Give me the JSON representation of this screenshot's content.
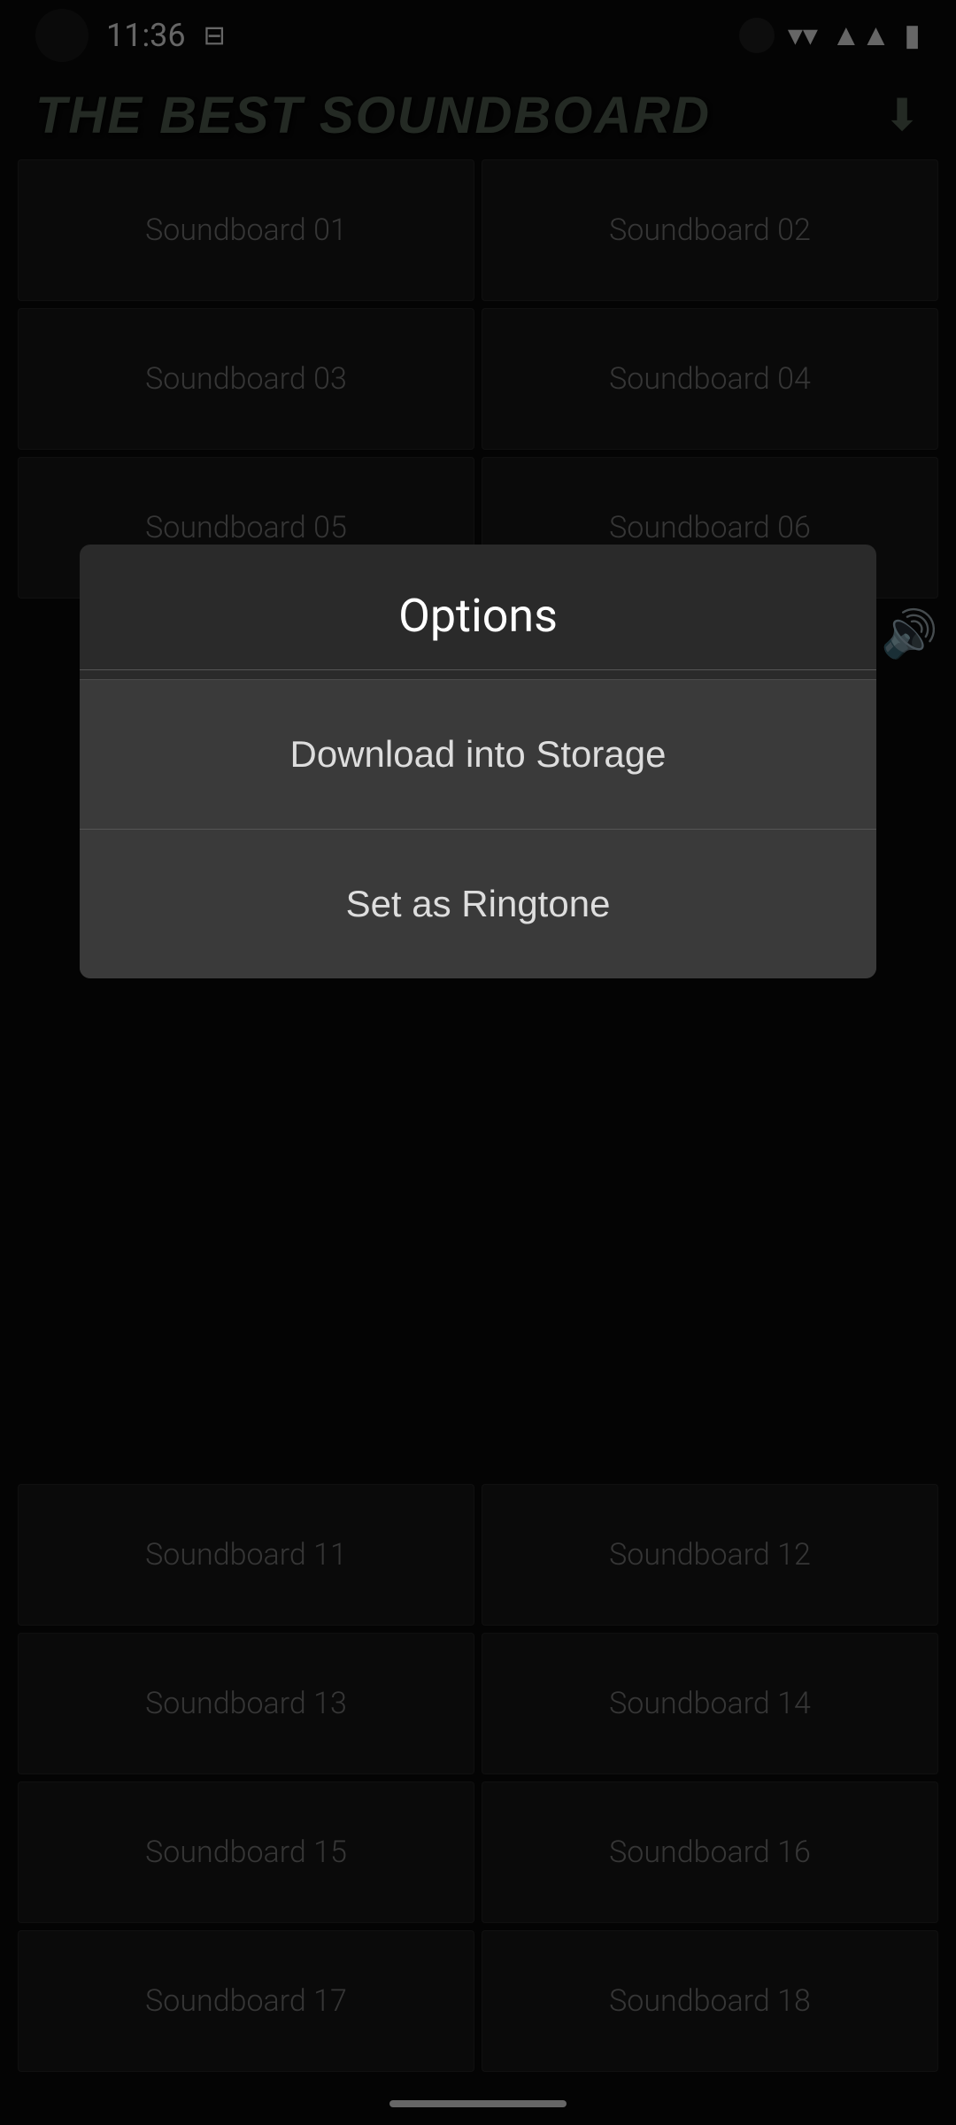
{
  "statusBar": {
    "time": "11:36",
    "wifiIcon": "▼",
    "signalIcon": "📶",
    "batteryIcon": "🔋"
  },
  "header": {
    "title": "THE BEST SOUNDBOARD",
    "downloadIcon": "⬇"
  },
  "modal": {
    "title": "Options",
    "buttons": [
      {
        "id": "download",
        "label": "Download into Storage"
      },
      {
        "id": "ringtone",
        "label": "Set as Ringtone"
      }
    ]
  },
  "soundboard": {
    "items": [
      {
        "id": "01",
        "label": "Soundboard 01"
      },
      {
        "id": "02",
        "label": "Soundboard 02"
      },
      {
        "id": "03",
        "label": "Soundboard 03"
      },
      {
        "id": "04",
        "label": "Soundboard 04"
      },
      {
        "id": "05",
        "label": "Soundboard 05"
      },
      {
        "id": "06",
        "label": "Soundboard 06"
      },
      {
        "id": "11",
        "label": "Soundboard 11"
      },
      {
        "id": "12",
        "label": "Soundboard 12"
      },
      {
        "id": "13",
        "label": "Soundboard 13"
      },
      {
        "id": "14",
        "label": "Soundboard 14"
      },
      {
        "id": "15",
        "label": "Soundboard 15"
      },
      {
        "id": "16",
        "label": "Soundboard 16"
      },
      {
        "id": "17",
        "label": "Soundboard 17"
      },
      {
        "id": "18",
        "label": "Soundboard 18"
      }
    ]
  },
  "colors": {
    "background": "#0a0a0a",
    "gridItemBg": "#1a1a1a",
    "overlayBg": "rgba(0,0,0,0.6)",
    "modalBg": "#2a2a2a",
    "modalButtonBg": "#3a3a3a",
    "titleColor": "#5a6a5a",
    "volumeColor": "#4a8a4a"
  }
}
